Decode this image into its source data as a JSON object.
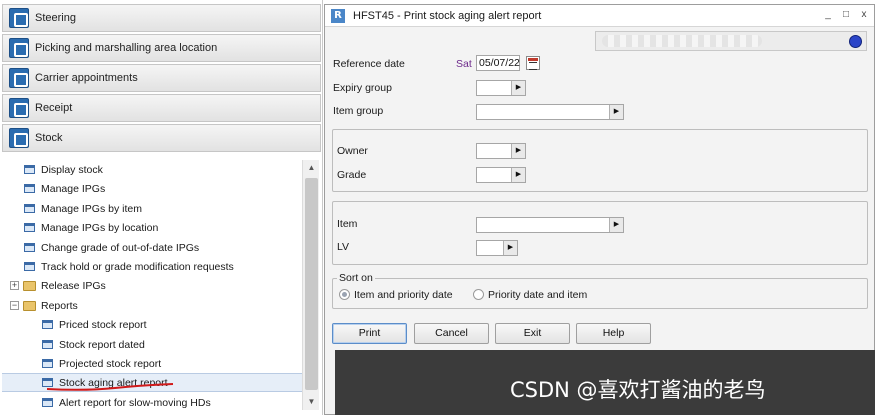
{
  "nav": {
    "headers": [
      {
        "label": "Steering",
        "icon": "steering-icon"
      },
      {
        "label": "Picking and marshalling area location",
        "icon": "picking-icon"
      },
      {
        "label": "Carrier appointments",
        "icon": "calendar-icon"
      },
      {
        "label": "Receipt",
        "icon": "receipt-icon"
      },
      {
        "label": "Stock",
        "icon": "stock-icon"
      }
    ],
    "items": [
      {
        "label": "Display stock"
      },
      {
        "label": "Manage IPGs"
      },
      {
        "label": "Manage IPGs by item"
      },
      {
        "label": "Manage IPGs by location"
      },
      {
        "label": "Change grade of out-of-date IPGs"
      },
      {
        "label": "Track hold or grade modification requests"
      },
      {
        "label": "Release IPGs",
        "expander": "+"
      },
      {
        "label": "Reports",
        "expander": "−"
      },
      {
        "label": "Priced stock report"
      },
      {
        "label": "Stock report dated"
      },
      {
        "label": "Projected stock report"
      },
      {
        "label": "Stock aging alert report"
      },
      {
        "label": "Alert report for slow-moving HDs"
      }
    ]
  },
  "window": {
    "title": "HFST45 - Print stock aging alert report",
    "app_icon_letter": "R",
    "controls": {
      "minimize": "_",
      "maximize": "□",
      "close": "x"
    }
  },
  "form": {
    "reference_date_label": "Reference date",
    "reference_day": "Sat",
    "reference_date_value": "05/07/22",
    "expiry_group_label": "Expiry group",
    "item_group_label": "Item group",
    "owner_label": "Owner",
    "grade_label": "Grade",
    "item_label": "Item",
    "lv_label": "LV",
    "sort_on_label": "Sort on",
    "sort_options": [
      "Item and priority date",
      "Priority date and item"
    ]
  },
  "buttons": {
    "print": "Print",
    "cancel": "Cancel",
    "exit": "Exit",
    "help": "Help"
  },
  "watermark": "CSDN @喜欢打酱油的老鸟",
  "colors": {
    "accent": "#2b6cb0",
    "day_name": "#6d2a8b",
    "underline": "#d11a1a"
  }
}
